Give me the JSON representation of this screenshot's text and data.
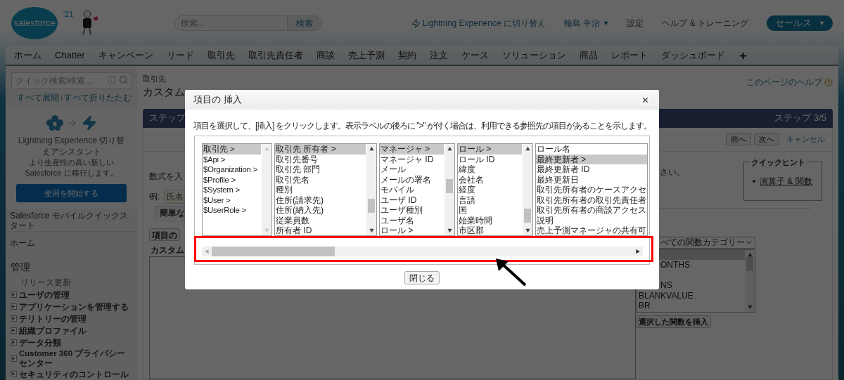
{
  "header": {
    "logo": "salesforce",
    "logo_badge": "'21",
    "search": {
      "placeholder": "検索...",
      "button": "検索"
    },
    "links": [
      {
        "kind": "lightning",
        "label": "Lightning Experience に切り替え"
      },
      {
        "kind": "user",
        "label": "輪島 幸治"
      },
      {
        "kind": "plain",
        "label": "設定"
      },
      {
        "kind": "plain",
        "label": "ヘルプ & トレーニング"
      }
    ],
    "app_menu": "セールス"
  },
  "nav_tabs": [
    "ホーム",
    "Chatter",
    "キャンペーン",
    "リード",
    "取引先",
    "取引先責任者",
    "商談",
    "売上予測",
    "契約",
    "注文",
    "ケース",
    "ソリューション",
    "商品",
    "レポート",
    "ダッシュボード"
  ],
  "sidebar": {
    "search_placeholder": "クイック検索/検索...",
    "expand_all": "すべて展開",
    "collapse_all": "すべて折りたたむ",
    "assistant": {
      "title": "Lightning Experience 切り替えアシスタント",
      "text": "より生産性の高い新しい Salesforce に移行します。",
      "button": "使用を開始する"
    },
    "sections": [
      "Salesforce モバイルクイックスタート",
      "ホーム"
    ],
    "admin": {
      "title": "管理",
      "plain_item": "リリース更新",
      "items": [
        "ユーザの管理",
        "アプリケーションを管理する",
        "テリトリーの管理",
        "組織プロファイル",
        "データ分類",
        "Customer 360 プライバシーセンター",
        "セキュリティのコントロール"
      ]
    }
  },
  "content": {
    "breadcrumb": "取引先",
    "title": "カスタム",
    "help_link": "このページのヘルプ",
    "step_left": "ステップ",
    "step_right": "ステップ 3/5",
    "buttons": [
      "前へ",
      "次へ"
    ],
    "cancel": "キャンセル",
    "left": {
      "prompt": "数式を入",
      "example_label": "例:",
      "example_value": "氏名",
      "tab": "簡単な",
      "insert_button": "項目の",
      "field_label": "カスタム"
    },
    "right": {
      "prompt_tail": "さい。",
      "quick_hint": {
        "title": "クイックヒント",
        "link": "演算子 & 関数"
      },
      "category": "べての関数カテゴリー",
      "functions": [
        {
          "selected": true
        },
        {
          "label": "ONTHS",
          "selected": false
        },
        {
          "selected": false
        },
        {
          "label": "NS",
          "selected": false
        },
        {
          "label": "BLANKVALUE",
          "selected": false
        },
        {
          "label": "BR",
          "selected": false
        }
      ],
      "insert_function": "選択した関数を挿入"
    }
  },
  "dialog": {
    "title": "項目の 挿入",
    "instruction": "項目を選択して、[挿入] をクリックします。表示ラベルの後ろに \">\" が付く場合は、利用できる参照先の項目があることを示します。",
    "lists": [
      {
        "items": [
          {
            "label": "取引先 >",
            "selected": true
          },
          {
            "label": "$Api >",
            "selected": false
          },
          {
            "label": "$Organization >",
            "selected": false
          },
          {
            "label": "$Profile >",
            "selected": false
          },
          {
            "label": "$System >",
            "selected": false
          },
          {
            "label": "$User >",
            "selected": false
          },
          {
            "label": "$UserRole >",
            "selected": false
          }
        ]
      },
      {
        "items": [
          {
            "label": "取引先 所有者 >",
            "selected": true
          },
          {
            "label": "取引先番号",
            "selected": false
          },
          {
            "label": "取引先 部門",
            "selected": false
          },
          {
            "label": "取引先名",
            "selected": false
          },
          {
            "label": "種別",
            "selected": false
          },
          {
            "label": "住所(請求先)",
            "selected": false
          },
          {
            "label": "住所(納入先)",
            "selected": false
          },
          {
            "label": "従業員数",
            "selected": false
          },
          {
            "label": "所有者 ID",
            "selected": false
          }
        ]
      },
      {
        "items": [
          {
            "label": "マネージャ >",
            "selected": true
          },
          {
            "label": "マネージャ ID",
            "selected": false
          },
          {
            "label": "メール",
            "selected": false
          },
          {
            "label": "メールの署名",
            "selected": false
          },
          {
            "label": "モバイル",
            "selected": false
          },
          {
            "label": "ユーザ ID",
            "selected": false
          },
          {
            "label": "ユーザ種別",
            "selected": false
          },
          {
            "label": "ユーザ名",
            "selected": false
          },
          {
            "label": "ロール >",
            "selected": false
          }
        ]
      },
      {
        "items": [
          {
            "label": "ロール >",
            "selected": true
          },
          {
            "label": "ロール ID",
            "selected": false
          },
          {
            "label": "緯度",
            "selected": false
          },
          {
            "label": "会社名",
            "selected": false
          },
          {
            "label": "経度",
            "selected": false
          },
          {
            "label": "言語",
            "selected": false
          },
          {
            "label": "国",
            "selected": false
          },
          {
            "label": "始業時間",
            "selected": false
          },
          {
            "label": "市区郡",
            "selected": false
          }
        ]
      },
      {
        "items": [
          {
            "label": "ロール名",
            "selected": false
          },
          {
            "label": "最終更新者 >",
            "selected": true
          },
          {
            "label": "最終更新者 ID",
            "selected": false
          },
          {
            "label": "最終更新日",
            "selected": false
          },
          {
            "label": "取引先所有者のケースアクセ",
            "selected": false
          },
          {
            "label": "取引先所有者の取引先責任者",
            "selected": false
          },
          {
            "label": "取引先所有者の商談アクセス",
            "selected": false
          },
          {
            "label": "説明",
            "selected": false
          },
          {
            "label": "売上予測マネージャの共有可",
            "selected": false
          }
        ]
      }
    ],
    "close_button": "閉じる"
  }
}
